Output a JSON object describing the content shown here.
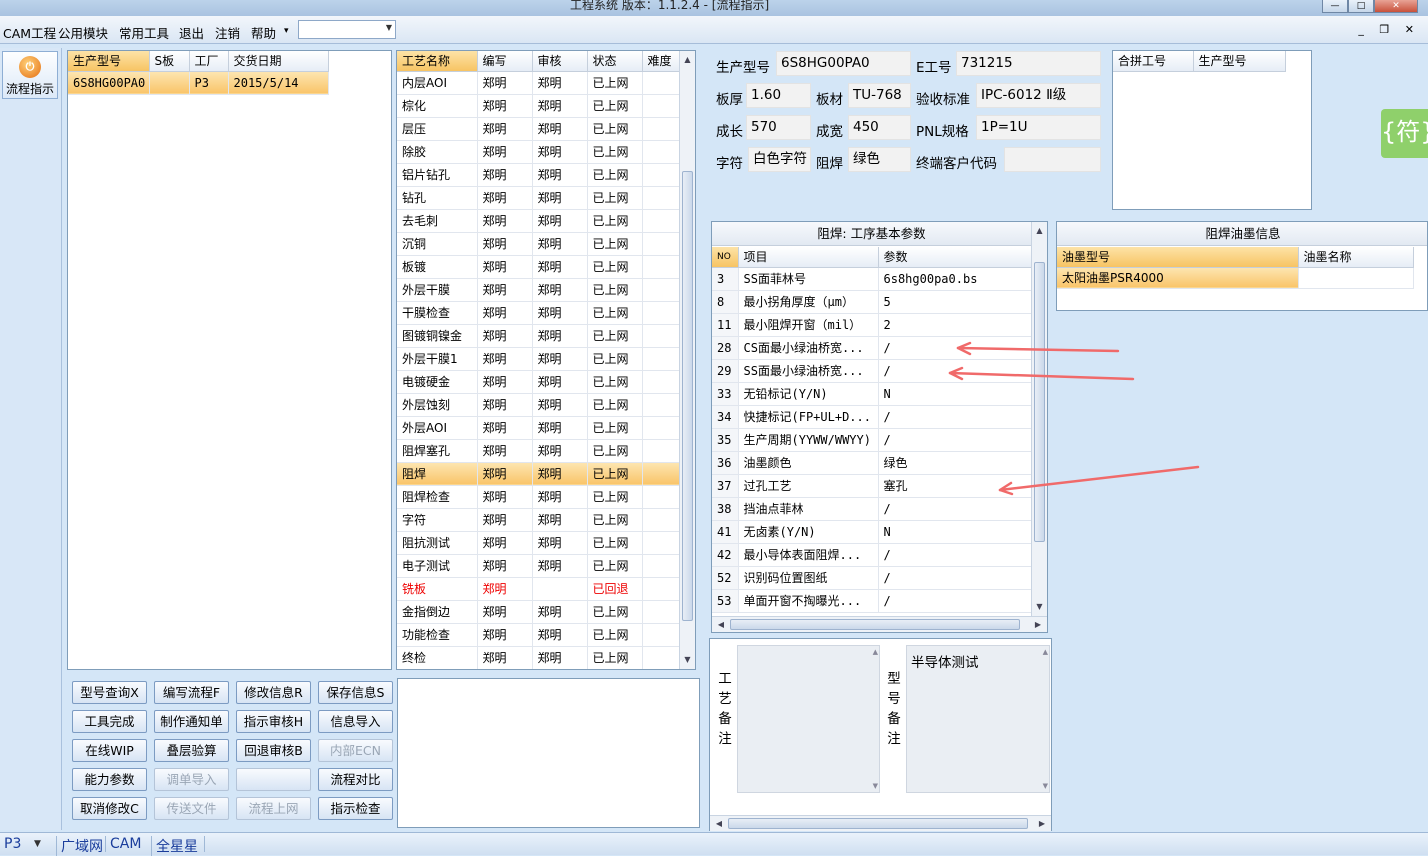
{
  "window": {
    "title": "工程系统   版本：1.1.2.4 - [流程指示]",
    "min": "—",
    "max": "□",
    "close": "✕"
  },
  "menu": {
    "items": [
      "CAM工程",
      "公用模块",
      "常用工具",
      "退出",
      "注销",
      "帮助"
    ],
    "help_arrow": "▾",
    "combo_value": "",
    "mdi": "_ ❐ ✕"
  },
  "nav": {
    "flow_label": "流程指示",
    "flow_icon_glyph": "⏻"
  },
  "orders": {
    "headers": [
      "生产型号",
      "S板",
      "工厂",
      "交货日期"
    ],
    "rows": [
      {
        "model": "6S8HG00PA0",
        "s": "",
        "factory": "P3",
        "date": "2015/5/14"
      }
    ]
  },
  "process": {
    "headers": [
      "工艺名称",
      "编写",
      "审核",
      "状态",
      "难度"
    ],
    "rows": [
      {
        "name": "内层AOI",
        "writer": "郑明",
        "auditor": "郑明",
        "status": "已上网",
        "difficulty": ""
      },
      {
        "name": "棕化",
        "writer": "郑明",
        "auditor": "郑明",
        "status": "已上网",
        "difficulty": ""
      },
      {
        "name": "层压",
        "writer": "郑明",
        "auditor": "郑明",
        "status": "已上网",
        "difficulty": ""
      },
      {
        "name": "除胶",
        "writer": "郑明",
        "auditor": "郑明",
        "status": "已上网",
        "difficulty": ""
      },
      {
        "name": "铝片钻孔",
        "writer": "郑明",
        "auditor": "郑明",
        "status": "已上网",
        "difficulty": ""
      },
      {
        "name": "钻孔",
        "writer": "郑明",
        "auditor": "郑明",
        "status": "已上网",
        "difficulty": ""
      },
      {
        "name": "去毛刺",
        "writer": "郑明",
        "auditor": "郑明",
        "status": "已上网",
        "difficulty": ""
      },
      {
        "name": "沉铜",
        "writer": "郑明",
        "auditor": "郑明",
        "status": "已上网",
        "difficulty": ""
      },
      {
        "name": "板镀",
        "writer": "郑明",
        "auditor": "郑明",
        "status": "已上网",
        "difficulty": ""
      },
      {
        "name": "外层干膜",
        "writer": "郑明",
        "auditor": "郑明",
        "status": "已上网",
        "difficulty": ""
      },
      {
        "name": "干膜检查",
        "writer": "郑明",
        "auditor": "郑明",
        "status": "已上网",
        "difficulty": ""
      },
      {
        "name": "图镀铜镍金",
        "writer": "郑明",
        "auditor": "郑明",
        "status": "已上网",
        "difficulty": ""
      },
      {
        "name": "外层干膜1",
        "writer": "郑明",
        "auditor": "郑明",
        "status": "已上网",
        "difficulty": ""
      },
      {
        "name": "电镀硬金",
        "writer": "郑明",
        "auditor": "郑明",
        "status": "已上网",
        "difficulty": ""
      },
      {
        "name": "外层蚀刻",
        "writer": "郑明",
        "auditor": "郑明",
        "status": "已上网",
        "difficulty": ""
      },
      {
        "name": "外层AOI",
        "writer": "郑明",
        "auditor": "郑明",
        "status": "已上网",
        "difficulty": ""
      },
      {
        "name": "阻焊塞孔",
        "writer": "郑明",
        "auditor": "郑明",
        "status": "已上网",
        "difficulty": ""
      },
      {
        "name": "阻焊",
        "writer": "郑明",
        "auditor": "郑明",
        "status": "已上网",
        "difficulty": "",
        "selected": true
      },
      {
        "name": "阻焊检查",
        "writer": "郑明",
        "auditor": "郑明",
        "status": "已上网",
        "difficulty": ""
      },
      {
        "name": "字符",
        "writer": "郑明",
        "auditor": "郑明",
        "status": "已上网",
        "difficulty": ""
      },
      {
        "name": "阻抗测试",
        "writer": "郑明",
        "auditor": "郑明",
        "status": "已上网",
        "difficulty": ""
      },
      {
        "name": "电子测试",
        "writer": "郑明",
        "auditor": "郑明",
        "status": "已上网",
        "difficulty": ""
      },
      {
        "name": "铣板",
        "writer": "郑明",
        "auditor": "",
        "status": "已回退",
        "difficulty": "",
        "returned": true
      },
      {
        "name": "金指倒边",
        "writer": "郑明",
        "auditor": "郑明",
        "status": "已上网",
        "difficulty": ""
      },
      {
        "name": "功能检查",
        "writer": "郑明",
        "auditor": "郑明",
        "status": "已上网",
        "difficulty": ""
      },
      {
        "name": "终检",
        "writer": "郑明",
        "auditor": "郑明",
        "status": "已上网",
        "difficulty": ""
      }
    ]
  },
  "buttons": [
    [
      {
        "label": "型号查询X",
        "enabled": true
      },
      {
        "label": "编写流程F",
        "enabled": true
      },
      {
        "label": "修改信息R",
        "enabled": true
      },
      {
        "label": "保存信息S",
        "enabled": true
      }
    ],
    [
      {
        "label": "工具完成",
        "enabled": true
      },
      {
        "label": "制作通知单",
        "enabled": true
      },
      {
        "label": "指示审核H",
        "enabled": true
      },
      {
        "label": "信息导入",
        "enabled": true
      }
    ],
    [
      {
        "label": "在线WIP",
        "enabled": true
      },
      {
        "label": "叠层验算",
        "enabled": true
      },
      {
        "label": "回退审核B",
        "enabled": true
      },
      {
        "label": "内部ECN",
        "enabled": false
      }
    ],
    [
      {
        "label": "能力参数",
        "enabled": true
      },
      {
        "label": "调单导入",
        "enabled": false
      },
      {
        "label": "",
        "enabled": false
      },
      {
        "label": "流程对比",
        "enabled": true
      }
    ],
    [
      {
        "label": "取消修改C",
        "enabled": true
      },
      {
        "label": "传送文件",
        "enabled": false
      },
      {
        "label": "流程上网",
        "enabled": false
      },
      {
        "label": "指示检查",
        "enabled": true
      }
    ]
  ],
  "info": {
    "model_label": "生产型号",
    "model": "6S8HG00PA0",
    "e_label": "E工号",
    "e_no": "731215",
    "thick_label": "板厚",
    "thick": "1.60",
    "mat_label": "板材",
    "mat": "TU-768",
    "std_label": "验收标准",
    "std": "IPC-6012 Ⅱ级",
    "len_label": "成长",
    "len": "570",
    "wid_label": "成宽",
    "wid": "450",
    "pnl_label": "PNL规格",
    "pnl": "1P=1U",
    "char_label": "字符",
    "char": "白色字符",
    "mask_label": "阻焊",
    "mask": "绿色",
    "cust_label": "终端客户代码",
    "cust": ""
  },
  "merge": {
    "headers": [
      "合拼工号",
      "生产型号"
    ]
  },
  "params": {
    "title": "阻焊: 工序基本参数",
    "headers": [
      "NO",
      "项目",
      "参数"
    ],
    "rows": [
      {
        "no": "3",
        "item": "SS面菲林号",
        "value": "6s8hg00pa0.bs"
      },
      {
        "no": "8",
        "item": "最小拐角厚度（μm）",
        "value": "5"
      },
      {
        "no": "11",
        "item": "最小阻焊开窗（mil）",
        "value": "2"
      },
      {
        "no": "28",
        "item": "CS面最小绿油桥宽...",
        "value": "/"
      },
      {
        "no": "29",
        "item": "SS面最小绿油桥宽...",
        "value": "/"
      },
      {
        "no": "33",
        "item": "无铅标记(Y/N)",
        "value": "N"
      },
      {
        "no": "34",
        "item": "快捷标记(FP+UL+D...",
        "value": "/"
      },
      {
        "no": "35",
        "item": "生产周期(YYWW/WWYY)",
        "value": "/"
      },
      {
        "no": "36",
        "item": "油墨颜色",
        "value": "绿色"
      },
      {
        "no": "37",
        "item": "过孔工艺",
        "value": "塞孔"
      },
      {
        "no": "38",
        "item": "挡油点菲林",
        "value": "/"
      },
      {
        "no": "41",
        "item": "无卤素(Y/N)",
        "value": "N"
      },
      {
        "no": "42",
        "item": "最小导体表面阻焊...",
        "value": "/"
      },
      {
        "no": "52",
        "item": "识别码位置图纸",
        "value": "/"
      },
      {
        "no": "53",
        "item": "单面开窗不掏曝光...",
        "value": "/"
      }
    ]
  },
  "ink": {
    "title": "阻焊油墨信息",
    "headers": [
      "油墨型号",
      "油墨名称"
    ],
    "rows": [
      {
        "model": "太阳油墨PSR4000",
        "name": ""
      }
    ]
  },
  "notes": {
    "process_label": "工艺备注",
    "process_note": "",
    "model_label": "型号备注",
    "model_note": "半导体测试"
  },
  "badge": "{符}",
  "status": {
    "items": [
      "P3",
      "广域网",
      "CAM",
      "全星星"
    ]
  },
  "colors": {
    "highlight": "#f9c469",
    "annotation": "#f06a6a",
    "returned": "#e00000"
  }
}
